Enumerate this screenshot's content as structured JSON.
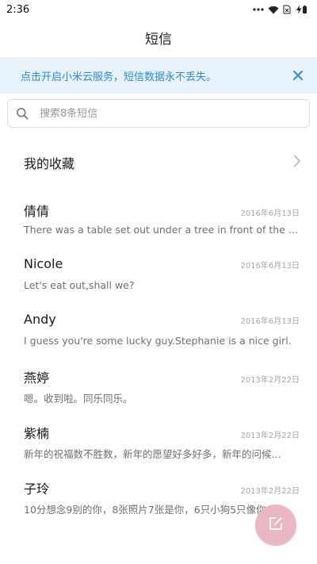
{
  "status_bar": {
    "time": "2:36"
  },
  "header": {
    "title": "短信"
  },
  "banner": {
    "text": "点击开启小米云服务，短信数据永不丢失。"
  },
  "search": {
    "placeholder": "搜索8条短信",
    "value": ""
  },
  "favorites": {
    "label": "我的收藏"
  },
  "conversations": [
    {
      "name": "倩倩",
      "date": "2016年6月13日",
      "preview": "There was a table set out under a tree in front of the ho..."
    },
    {
      "name": "Nicole",
      "date": "2016年6月13日",
      "preview": "Let's eat out,shall we?"
    },
    {
      "name": "Andy",
      "date": "2016年6月13日",
      "preview": "I guess you're some lucky guy.Stephanie is a nice girl."
    },
    {
      "name": "燕婷",
      "date": "2013年2月22日",
      "preview": "嗯。收到啦。同乐同乐。"
    },
    {
      "name": "紫楠",
      "date": "2013年2月22日",
      "preview": "新年的祝福数不胜数，新年的愿望好多好多，新年的问候..."
    },
    {
      "name": "子玲",
      "date": "2013年2月22日",
      "preview": "10分想念9别的你，8张照片7张是你，6只小狗5只像你，4..."
    }
  ],
  "colors": {
    "banner_bg": "#e8f2fb",
    "banner_text": "#2d8ad8",
    "fab": "#eab7c4"
  },
  "icons": [
    "wifi-icon",
    "battery-icon",
    "close-icon",
    "search-icon",
    "chevron-right-icon",
    "compose-icon"
  ]
}
